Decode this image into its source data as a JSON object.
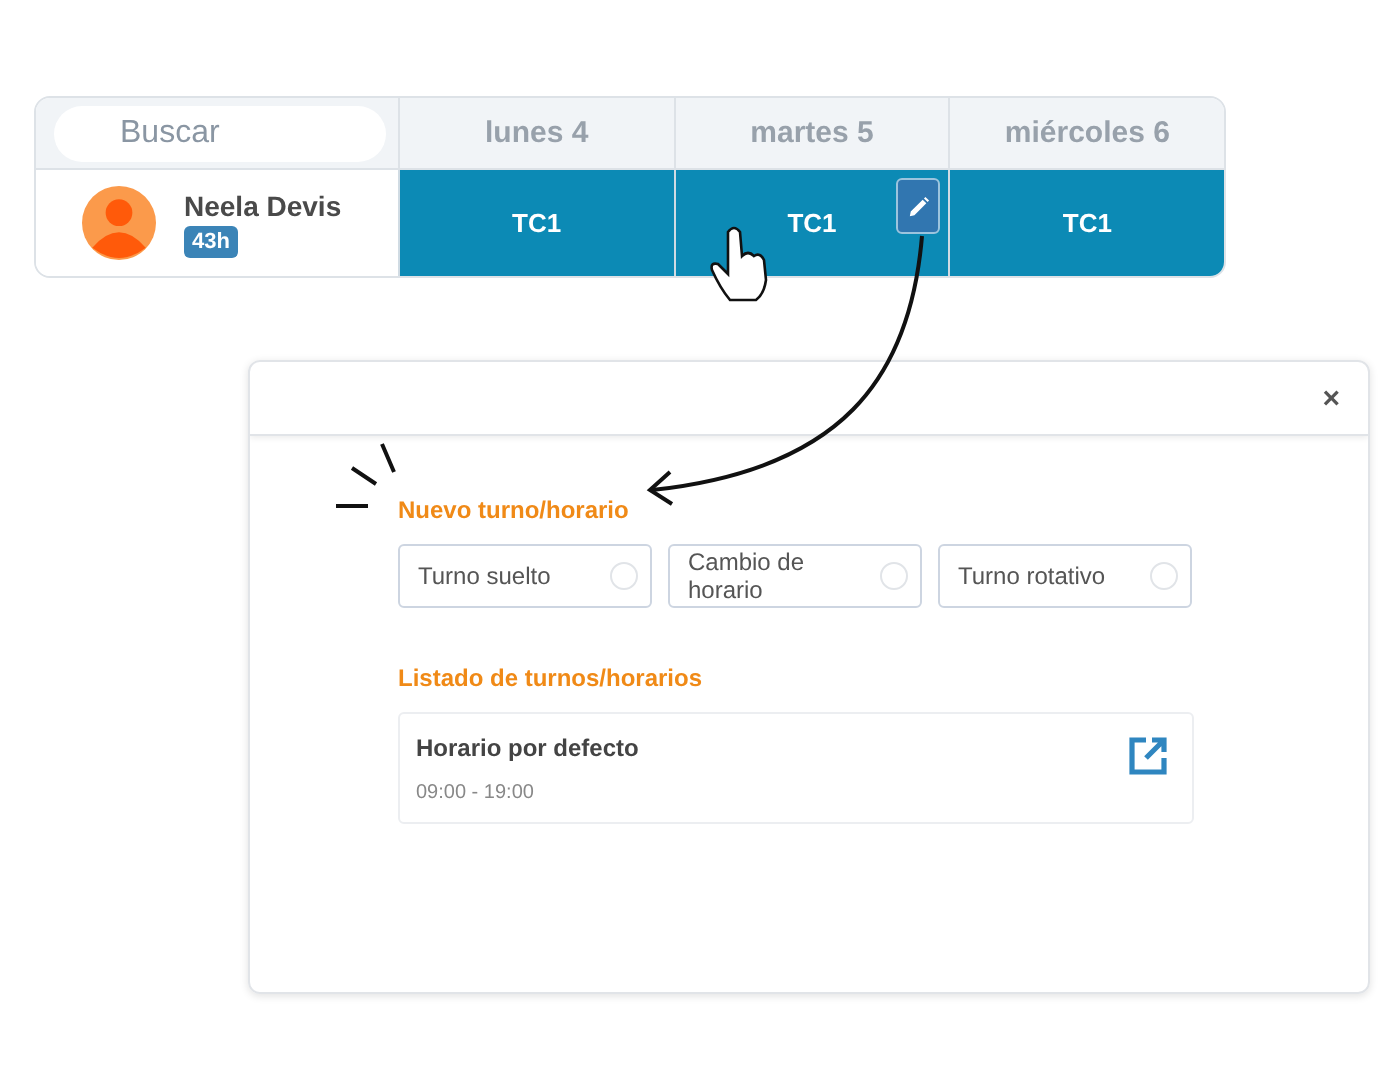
{
  "schedule": {
    "search": {
      "placeholder": "Buscar"
    },
    "days": [
      "lunes 4",
      "martes 5",
      "miércoles 6"
    ],
    "employee": {
      "name": "Neela Devis",
      "hours": "43h"
    },
    "shifts": [
      {
        "label": "TC1",
        "editing": false
      },
      {
        "label": "TC1",
        "editing": true
      },
      {
        "label": "TC1",
        "editing": false
      }
    ]
  },
  "modal": {
    "close": "×",
    "new_title": "Nuevo turno/horario",
    "options": [
      {
        "label": "Turno suelto",
        "selected": false
      },
      {
        "label": "Cambio de horario",
        "selected": false
      },
      {
        "label": "Turno rotativo",
        "selected": false
      }
    ],
    "list_title": "Listado de turnos/horarios",
    "items": [
      {
        "name": "Horario por defecto",
        "time": "09:00 - 19:00"
      }
    ]
  }
}
